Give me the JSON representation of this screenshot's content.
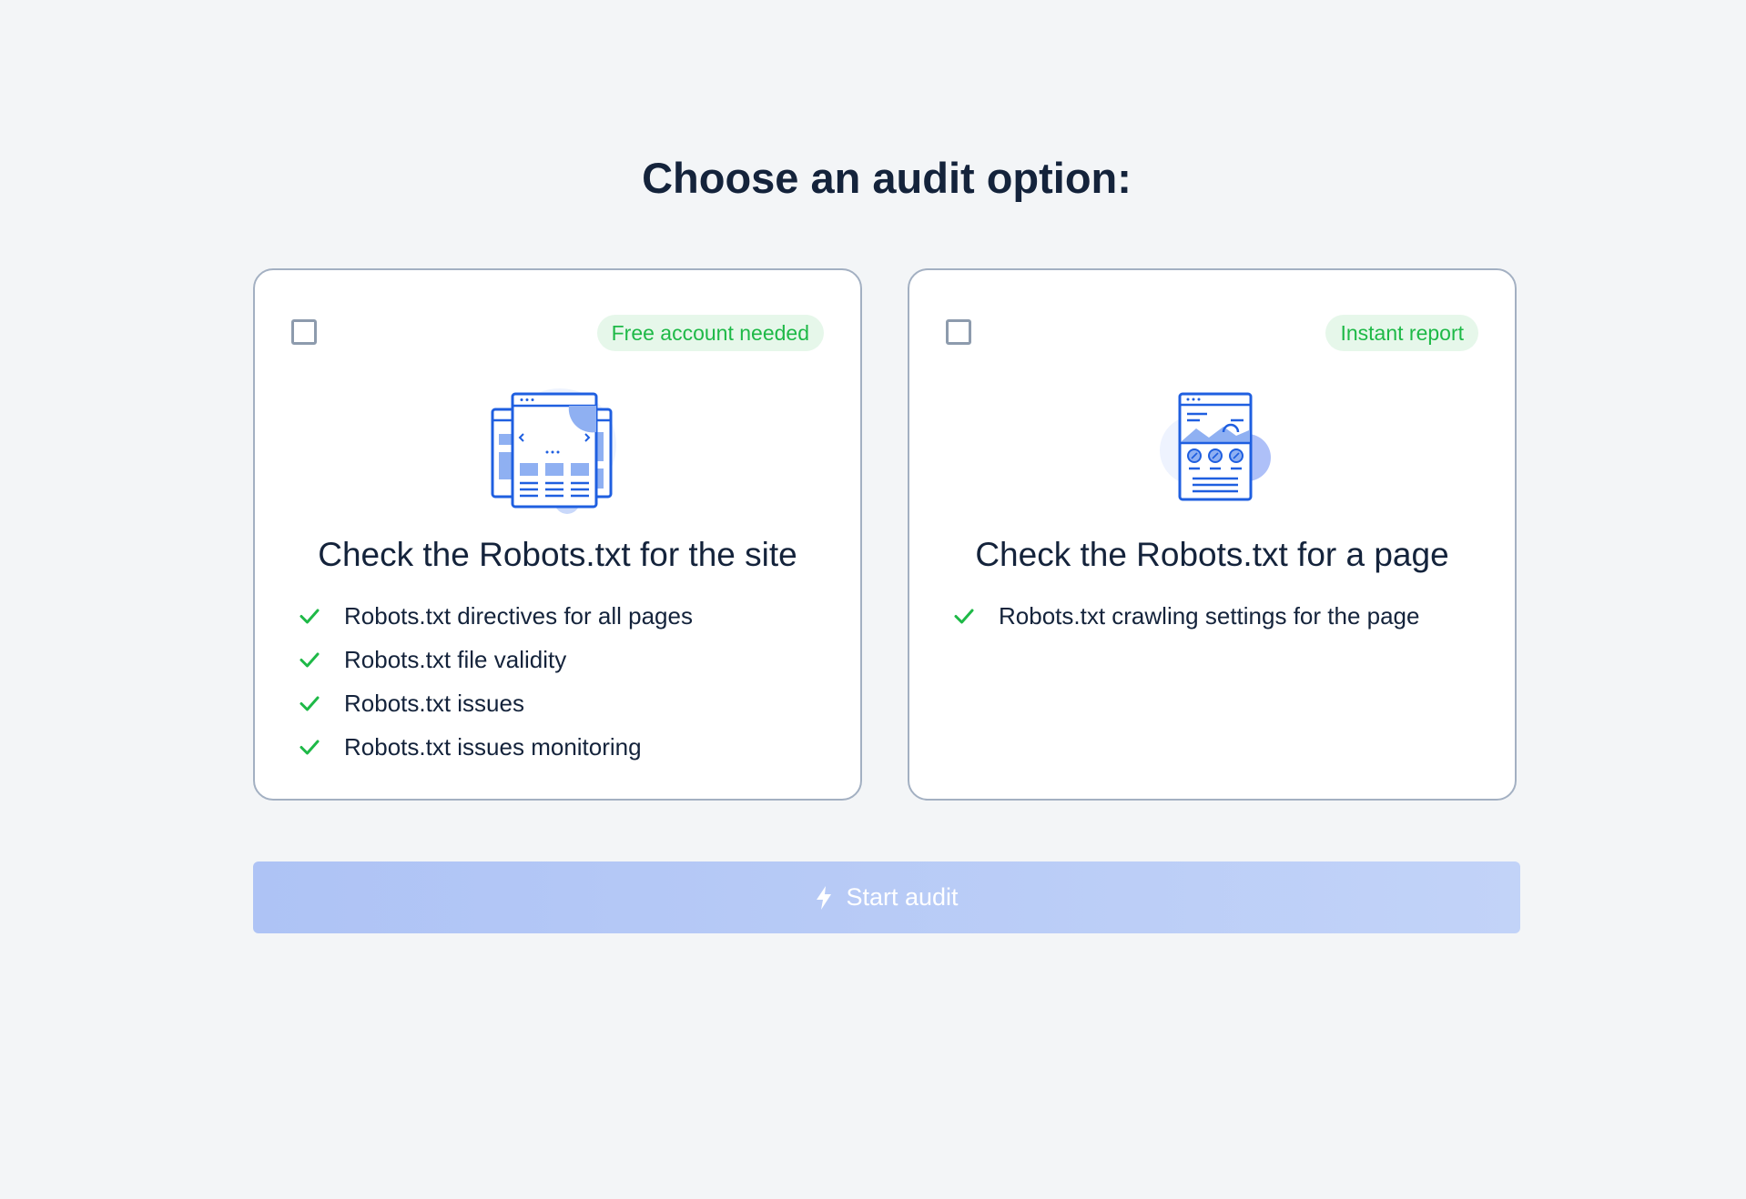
{
  "page": {
    "title": "Choose an audit option:"
  },
  "options": [
    {
      "badge": "Free account needed",
      "title": "Check the Robots.txt for the site",
      "illustration": "multi-page-browser-illustration",
      "features": [
        "Robots.txt directives for all pages",
        "Robots.txt file validity",
        "Robots.txt issues",
        "Robots.txt issues monitoring"
      ]
    },
    {
      "badge": "Instant report",
      "title": "Check the Robots.txt for a page",
      "illustration": "single-page-browser-illustration",
      "features": [
        "Robots.txt crawling settings for the page"
      ]
    }
  ],
  "action": {
    "start_label": "Start audit",
    "icon": "lightning-bolt-icon"
  },
  "colors": {
    "background": "#f3f5f7",
    "text": "#14233b",
    "badge_text": "#1eb947",
    "badge_bg": "#e6f7ea",
    "check": "#1eb947",
    "illustration_blue": "#1f5fe0",
    "button_disabled": "#b4c8f6"
  }
}
